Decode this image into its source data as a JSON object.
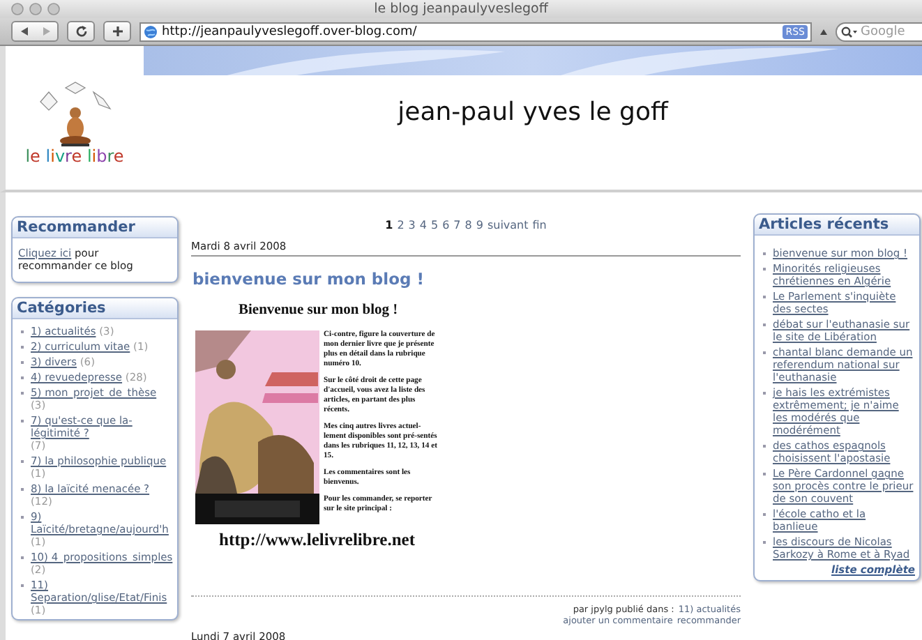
{
  "window": {
    "title": "le blog jeanpaulyveslegoff"
  },
  "toolbar": {
    "address": "http://jeanpaulyveslegoff.over-blog.com/",
    "rss": "RSS",
    "search": {
      "placeholder": "Google"
    }
  },
  "header": {
    "logo_text": "le livre libre",
    "title": "jean-paul yves le goff"
  },
  "recommend": {
    "title": "Recommander",
    "link": "Cliquez ici",
    "text": "pour recommander ce blog"
  },
  "categories": {
    "title": "Catégories",
    "items": [
      {
        "label": "1) actualités",
        "count": "(3)"
      },
      {
        "label": "2) curriculum vitae",
        "count": "(1)"
      },
      {
        "label": "3) divers",
        "count": "(6)"
      },
      {
        "label": "4) revuedepresse",
        "count": "(28)"
      },
      {
        "label": "5) mon_projet_de_thèse",
        "count": "(3)"
      },
      {
        "label": "7) qu'est-ce que la-légitimité ?",
        "count": "(7)"
      },
      {
        "label": "7) la philosophie publique",
        "count": "(1)"
      },
      {
        "label": "8) la laïcité menacée ?",
        "count": "(12)"
      },
      {
        "label": "9) Laïcité/bretagne/aujourd'h",
        "count": "(1)"
      },
      {
        "label": "10) 4_propositions_simples",
        "count": "(2)"
      },
      {
        "label": "11) Separation/glise/Etat/Finis",
        "count": "(1)"
      }
    ]
  },
  "pagination": {
    "pages": [
      {
        "label": "1",
        "selected": true
      },
      {
        "label": "2",
        "selected": false
      },
      {
        "label": "3",
        "selected": false
      },
      {
        "label": "4",
        "selected": false
      },
      {
        "label": "5",
        "selected": false
      },
      {
        "label": "6",
        "selected": false
      },
      {
        "label": "7",
        "selected": false
      },
      {
        "label": "8",
        "selected": false
      },
      {
        "label": "9",
        "selected": false
      }
    ],
    "next": "suivant",
    "last": "fin"
  },
  "posts": [
    {
      "date": "Mardi 8 avril 2008",
      "title": "bienvenue sur mon blog !",
      "heading": "Bienvenue sur mon blog !",
      "paragraphs": [
        "Ci-contre, figure la couverture de mon dernier livre que je présente plus en détail dans la rubrique numéro 10.",
        "Sur le côté droit de cette page d'accueil, vous avez la liste des articles, en partant des plus récents.",
        "Mes cinq autres livres actuel-lement disponibles sont pré-sentés dans les rubriques 11, 12, 13, 14 et 15.",
        "Les commentaires sont les bienvenus.",
        "Pour les commander, se reporter sur le site principal :"
      ],
      "url": "http://www.lelivrelibre.net",
      "byline": "par jpylg publié dans :",
      "category": "11) actualités",
      "actions": [
        "ajouter un commentaire",
        "recommander"
      ]
    },
    {
      "date": "Lundi 7 avril 2008"
    }
  ],
  "recent": {
    "title": "Articles récents",
    "items": [
      "bienvenue sur mon blog !",
      "Minorités religieuses chrétiennes en Algérie",
      "Le Parlement s'inquiète des sectes",
      "débat sur l'euthanasie sur le site de Libération",
      "chantal blanc demande un referendum national sur l'euthanasie",
      "je hais les extrémistes extrêmement; je n'aime les modérés que modérément",
      "des cathos espagnols choisissent l'apostasie",
      "Le Père Cardonnel gagne son procès contre le prieur de son couvent",
      "l'école catho et la banlieue",
      "les discours de Nicolas Sarkozy à Rome et à Ryad"
    ],
    "more": "liste complète"
  }
}
